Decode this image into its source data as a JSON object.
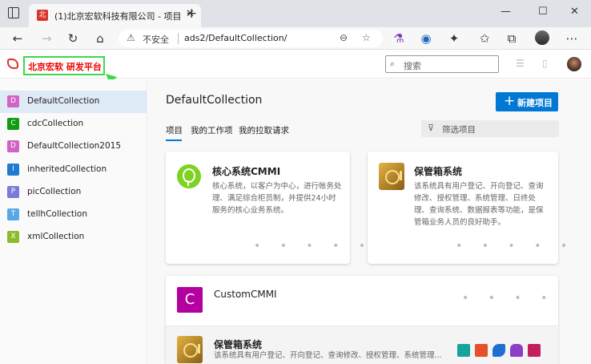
{
  "browser": {
    "tab_title": "(1)北京宏软科技有限公司 - 项目",
    "tab_favicon_text": "北",
    "tab_close": "✕",
    "new_tab": "+",
    "address_warning": "⚠",
    "address_insecure": "不安全",
    "address_url": "ads2/DefaultCollection/",
    "controls": {
      "minimize": "—",
      "maximize": "☐",
      "close": "✕"
    }
  },
  "header": {
    "org_name": "北京宏软 研发平台",
    "search_placeholder": "搜索",
    "search_glyph": "⌕"
  },
  "sidebar": {
    "items": [
      {
        "badge": "D",
        "label": "DefaultCollection",
        "color": "#d063c4",
        "active": true
      },
      {
        "badge": "C",
        "label": "cdcCollection",
        "color": "#119b11"
      },
      {
        "badge": "D",
        "label": "DefaultCollection2015",
        "color": "#d063c4"
      },
      {
        "badge": "I",
        "label": "inheritedCollection",
        "color": "#1f7ad2"
      },
      {
        "badge": "P",
        "label": "picCollection",
        "color": "#7a7ad8"
      },
      {
        "badge": "T",
        "label": "tellhCollection",
        "color": "#58a8e8"
      },
      {
        "badge": "X",
        "label": "xmlCollection",
        "color": "#8cbb2a"
      }
    ]
  },
  "main": {
    "title": "DefaultCollection",
    "new_project_icon": "+",
    "new_project_label": "新建项目",
    "tabs": [
      {
        "label": "项目",
        "active": true
      },
      {
        "label": "我的工作项"
      },
      {
        "label": "我的拉取请求"
      }
    ],
    "filter_glyph": "⊽",
    "filter_placeholder": "筛选项目",
    "projects": [
      {
        "name": "核心系统CMMI",
        "description": "核心系统，以客户为中心，进行帐务处理、满足综合柜员制，并提供24小时服务的核心业务系统。"
      },
      {
        "name": "保管箱系统",
        "description": "该系统具有用户登记、开向登记、查询修改、授权管理、系统管理、日终处理、查询系统、数据报表等功能，是保管箱业务人员的良好助手。"
      },
      {
        "name": "CustomCMMI",
        "icon_letter": "C"
      },
      {
        "name": "保管箱系统",
        "description": "该系统具有用户登记、开向登记、查询修改、授权管理、系统管理..."
      }
    ],
    "dots": "• • • • •",
    "dots_short": "• • • •"
  },
  "colors": {
    "accent": "#0078d4",
    "brand_red": "#d9342b",
    "highlight_green": "#3cd94a"
  }
}
